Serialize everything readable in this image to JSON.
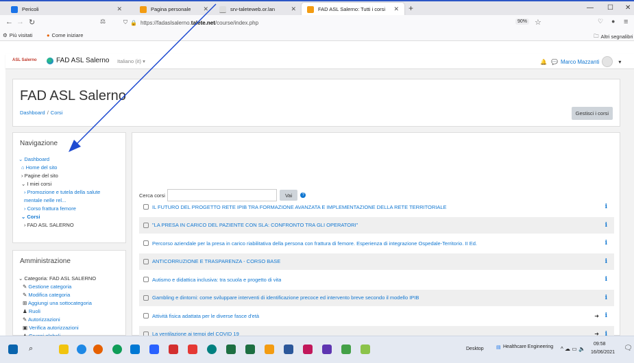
{
  "browser": {
    "tabs": [
      {
        "label": "Pericoli",
        "icon": "moodle-icon",
        "color": "#1a73e8"
      },
      {
        "label": "Pagina personale",
        "icon": "moodle-icon",
        "color": "#f39c12"
      },
      {
        "label": "srv-taleteweb.or.lan",
        "icon": "blank-icon",
        "color": "#dddddd"
      },
      {
        "label": "FAD ASL Salerno: Tutti i corsi",
        "icon": "moodle-icon",
        "color": "#f39c12"
      }
    ],
    "url_prefix": "https://fadaslsalerno.",
    "url_host": "talete.net",
    "url_path": "/course/index.php",
    "zoom": "90%",
    "bookmarks": [
      "Più visitati",
      "Come iniziare"
    ],
    "other_bookmarks": "Altri segnalibri"
  },
  "header": {
    "logo_text": "ASL Salerno",
    "brand": "FAD ASL Salerno",
    "language": "Italiano (it)",
    "user": "Marco Mazzanti"
  },
  "page": {
    "title": "FAD ASL Salerno",
    "breadcrumb": [
      "Dashboard",
      "Corsi"
    ],
    "manage_button": "Gestisci i corsi"
  },
  "navigation": {
    "title": "Navigazione",
    "items": [
      {
        "label": "Dashboard",
        "prefix": "⌄"
      },
      {
        "label": "Home del sito",
        "prefix": "⌂"
      },
      {
        "label": "Pagine del sito",
        "prefix": ">"
      },
      {
        "label": "I miei corsi",
        "prefix": "⌄"
      },
      {
        "label": "Promozione e tutela della salute",
        "prefix": ">"
      },
      {
        "label": "mentale nelle rel...",
        "prefix": ""
      },
      {
        "label": "Corso frattura femore",
        "prefix": ">"
      },
      {
        "label": "Corsi",
        "prefix": "⌄"
      },
      {
        "label": "FAD ASL SALERNO",
        "prefix": ">"
      }
    ]
  },
  "administration": {
    "title": "Amministrazione",
    "items": [
      {
        "label": "Categoria: FAD ASL SALERNO",
        "prefix": "⌄"
      },
      {
        "label": "Gestione categoria",
        "prefix": "✎"
      },
      {
        "label": "Modifica categoria",
        "prefix": "✎"
      },
      {
        "label": "Aggiungi una sottocategoria",
        "prefix": "+"
      },
      {
        "label": "Ruoli",
        "prefix": "♟"
      },
      {
        "label": "Autorizzazioni",
        "prefix": "✎"
      },
      {
        "label": "Verifica autorizzazioni",
        "prefix": "🔒"
      },
      {
        "label": "Gruppi globali",
        "prefix": "♟"
      }
    ]
  },
  "search": {
    "label": "Cerca corsi",
    "button": "Vai",
    "help": "?"
  },
  "courses": [
    {
      "name": "IL FUTURO DEL PROGETTO RETE IPIB TRA FORMAZIONE AVANZATA E IMPLEMENTAZIONE DELLA RETE TERRITORIALE",
      "enrol": false
    },
    {
      "name": "\"LA PRESA IN CARICO DEL PAZIENTE CON SLA: CONFRONTO TRA GLI OPERATORI\"",
      "enrol": false
    },
    {
      "name": "Percorso aziendale per la presa in carico riabilitativa della persona con frattura di femore. Esperienza di integrazione Ospedale-Territorio. II Ed.",
      "enrol": false
    },
    {
      "name": "ANTICORRUZIONE E TRASPARENZA - CORSO BASE",
      "enrol": false
    },
    {
      "name": "Autismo e didattica inclusiva: tra scuola e progetto di vita",
      "enrol": false
    },
    {
      "name": "Gambling e dintorni: come sviluppare interventi di identificazione precoce ed intervento breve secondo il modello IPIB",
      "enrol": false
    },
    {
      "name": "Attività fisica adattata per le diverse fasce d'età",
      "enrol": true
    },
    {
      "name": "La ventilazione ai tempi del COVID 19",
      "enrol": true
    }
  ],
  "info_glyph": "i",
  "enrol_glyph": "➜",
  "taskbar": {
    "desktop": "Desktop",
    "app": "Healthcare Engineering",
    "time": "09:58",
    "date": "16/06/2021"
  }
}
